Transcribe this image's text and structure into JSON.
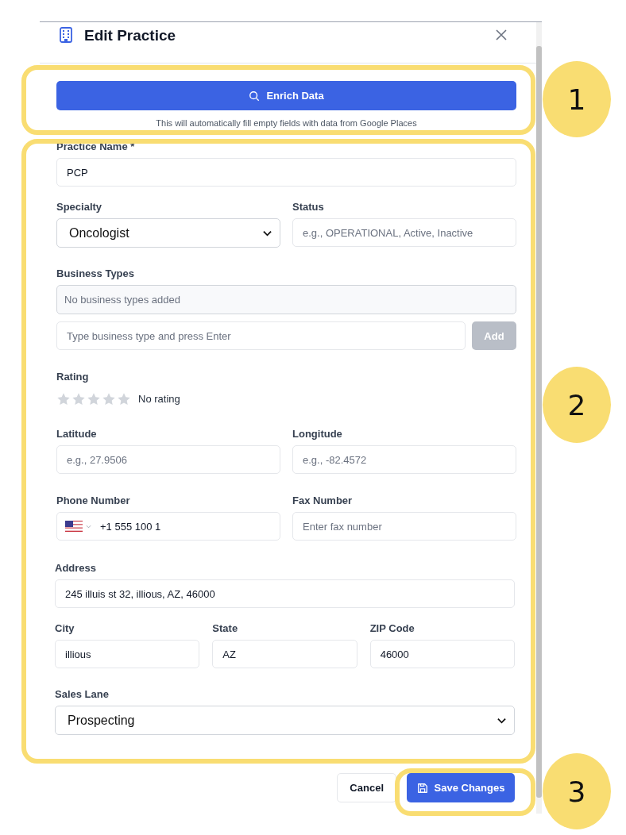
{
  "dialog": {
    "title": "Edit Practice"
  },
  "enrich": {
    "button": "Enrich Data",
    "hint": "This will automatically fill empty fields with data from Google Places"
  },
  "practice_name": {
    "label": "Practice Name *",
    "value": "PCP"
  },
  "specialty": {
    "label": "Specialty",
    "value": "Oncologist"
  },
  "status": {
    "label": "Status",
    "placeholder": "e.g., OPERATIONAL, Active, Inactive"
  },
  "business_types": {
    "label": "Business Types",
    "empty_text": "No business types added",
    "input_placeholder": "Type business type and press Enter",
    "add_button": "Add",
    "add_disabled": true
  },
  "rating": {
    "label": "Rating",
    "stars": 0,
    "text": "No rating"
  },
  "latitude": {
    "label": "Latitude",
    "placeholder": "e.g., 27.9506"
  },
  "longitude": {
    "label": "Longitude",
    "placeholder": "e.g., -82.4572"
  },
  "phone": {
    "label": "Phone Number",
    "value": "+1 555 100 1"
  },
  "fax": {
    "label": "Fax Number",
    "placeholder": "Enter fax number"
  },
  "address": {
    "label": "Address",
    "value": "245 illuis st 32, illious, AZ, 46000"
  },
  "city": {
    "label": "City",
    "value": "illious"
  },
  "state": {
    "label": "State",
    "value": "AZ"
  },
  "zip": {
    "label": "ZIP Code",
    "value": "46000"
  },
  "sales_lane": {
    "label": "Sales Lane",
    "value": "Prospecting"
  },
  "buttons": {
    "cancel": "Cancel",
    "save": "Save Changes"
  },
  "annotations": [
    {
      "label": "1"
    },
    {
      "label": "2"
    },
    {
      "label": "3"
    }
  ]
}
